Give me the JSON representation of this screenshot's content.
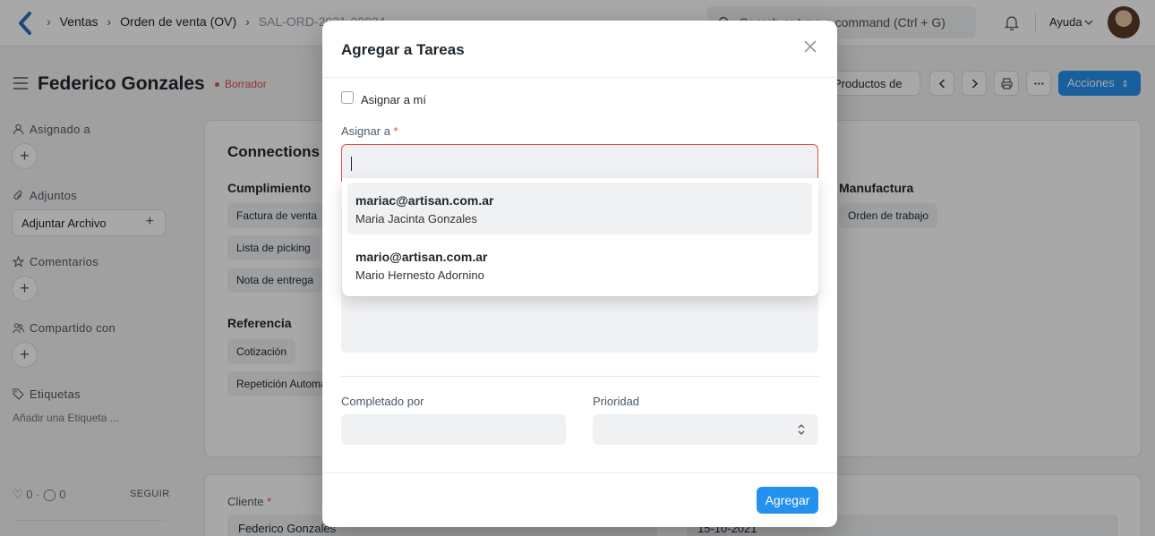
{
  "navbar": {
    "breadcrumbs": [
      "Ventas",
      "Orden de venta (OV)",
      "SAL-ORD-2021-00024"
    ],
    "search_placeholder": "Search or type a command (Ctrl + G)",
    "help_label": "Ayuda"
  },
  "page": {
    "title": "Federico Gonzales",
    "status": "Borrador",
    "products_button": "Productos de",
    "actions_button": "Acciones"
  },
  "sidebar": {
    "assigned_label": "Asignado a",
    "attachments_label": "Adjuntos",
    "attach_button": "Adjuntar Archivo",
    "comments_label": "Comentarios",
    "shared_label": "Compartido con",
    "tags_label": "Etiquetas",
    "add_tag": "Añadir una Etiqueta ...",
    "likes": "0",
    "comments_count": "0",
    "follow": "SEGUIR"
  },
  "connections": {
    "title": "Connections",
    "groups": [
      {
        "title": "Cumplimiento",
        "items": [
          "Factura de venta",
          "Lista de picking",
          "Nota de entrega"
        ]
      },
      {
        "title": "Referencia",
        "items": [
          "Cotización",
          "Repetición Automática"
        ]
      },
      {
        "title": "Manufactura",
        "items": [
          "Orden de trabajo"
        ]
      }
    ]
  },
  "details": {
    "customer_label": "Cliente",
    "customer_value": "Federico Gonzales",
    "date_value": "15-10-2021"
  },
  "modal": {
    "title": "Agregar a Tareas",
    "assign_to_me": "Asignar a mí",
    "assign_to_label": "Asignar a",
    "assign_to_value": "",
    "suggestions": [
      {
        "email": "mariac@artisan.com.ar",
        "name": "Maria Jacinta Gonzales"
      },
      {
        "email": "mario@artisan.com.ar",
        "name": "Mario Hernesto Adornino"
      }
    ],
    "completed_by_label": "Completado por",
    "priority_label": "Prioridad",
    "add_button": "Agregar"
  },
  "colors": {
    "primary": "#2490ef",
    "danger": "#e24c4c",
    "field_bg": "#f0f1f3"
  }
}
